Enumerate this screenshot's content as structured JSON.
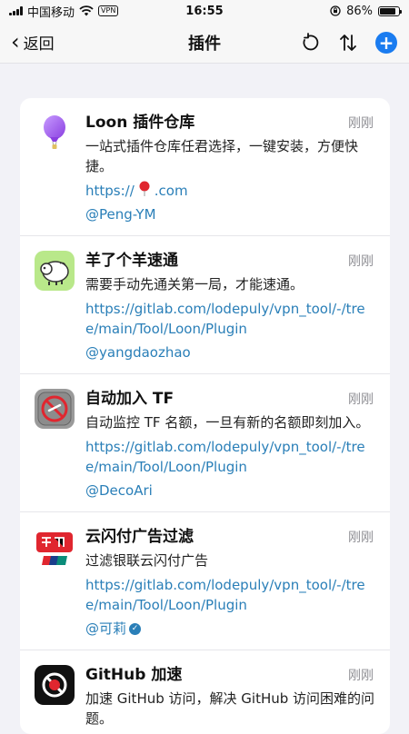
{
  "status_bar": {
    "carrier": "中国移动",
    "vpn_label": "VPN",
    "time": "16:55",
    "battery_percent": "86%",
    "battery_level": 0.86
  },
  "nav": {
    "back_label": "返回",
    "title": "插件"
  },
  "plugins": [
    {
      "name": "Loon 插件仓库",
      "time": "刚刚",
      "description": "一站式插件仓库任君选择，一键安装，方便快捷。",
      "link_prefix": "https://",
      "link_suffix": ".com",
      "author": "@Peng-YM",
      "icon": "balloon-icon"
    },
    {
      "name": "羊了个羊速通",
      "time": "刚刚",
      "description": "需要手动先通关第一局，才能速通。",
      "link": "https://gitlab.com/lodepuly/vpn_tool/-/tree/main/Tool/Loon/Plugin",
      "author": "@yangdaozhao",
      "icon": "sheep-icon"
    },
    {
      "name": "自动加入 TF",
      "time": "刚刚",
      "description": "自动监控 TF 名额，一旦有新的名额即刻加入。",
      "link": "https://gitlab.com/lodepuly/vpn_tool/-/tree/main/Tool/Loon/Plugin",
      "author": "@DecoAri",
      "icon": "no-testflight-icon"
    },
    {
      "name": "云闪付广告过滤",
      "time": "刚刚",
      "description": "过滤银联云闪付广告",
      "link": "https://gitlab.com/lodepuly/vpn_tool/-/tree/main/Tool/Loon/Plugin",
      "author": "@可莉",
      "icon": "unionpay-icon"
    },
    {
      "name": "GitHub 加速",
      "time": "刚刚",
      "description": "加速 GitHub 访问，解决 GitHub 访问困难的问题。",
      "icon": "no-github-icon"
    }
  ],
  "colors": {
    "accent": "#1a7cf0",
    "link": "#2a7fb8",
    "background": "#f2f2f7"
  }
}
